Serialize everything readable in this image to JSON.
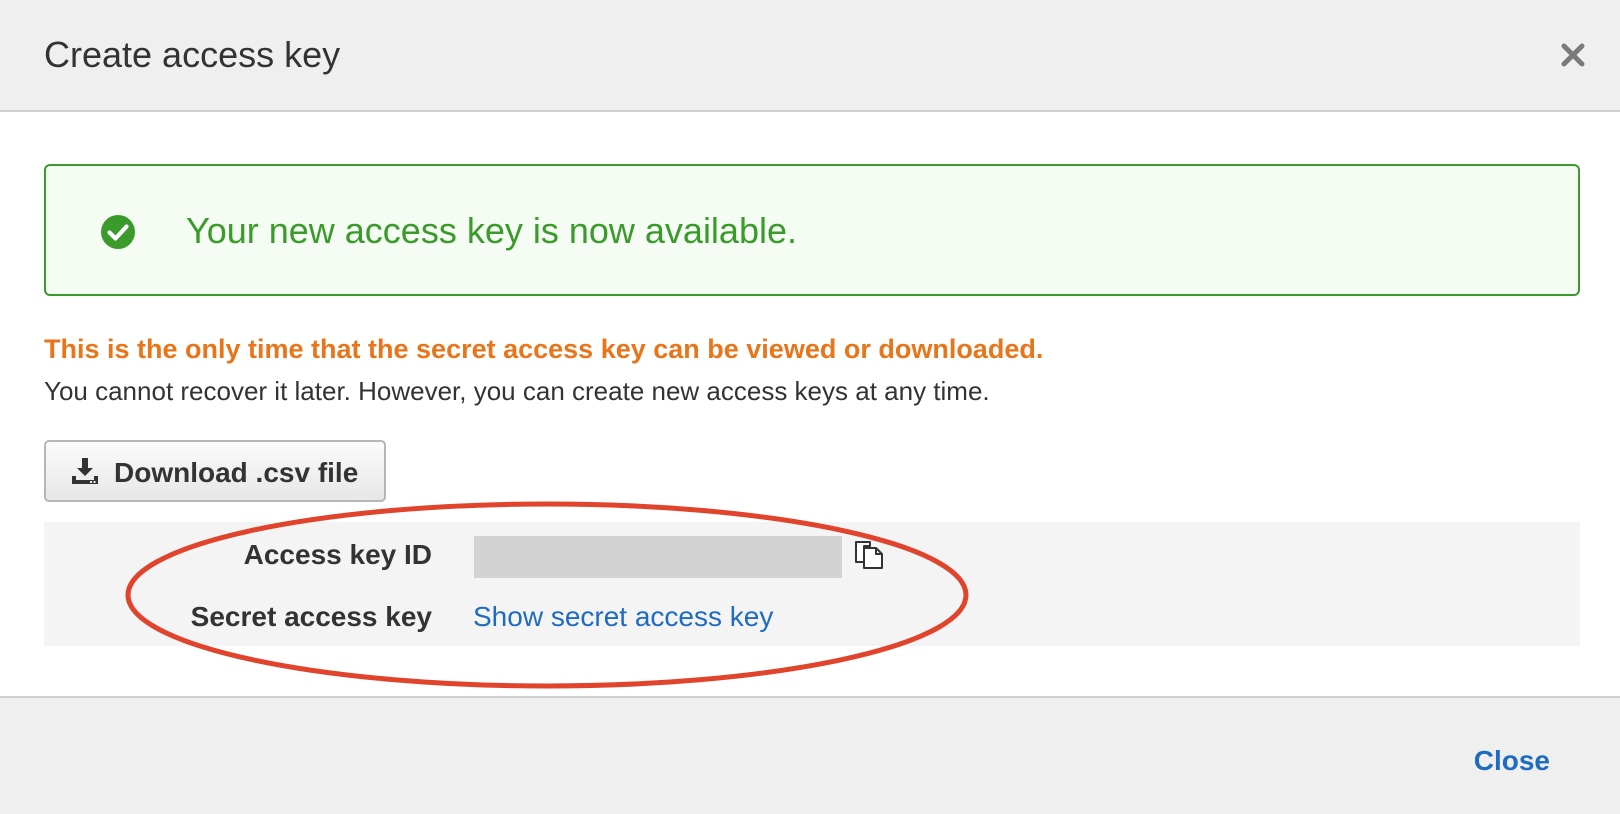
{
  "dialog": {
    "title": "Create access key",
    "close_icon": "close-x-icon"
  },
  "success_alert": {
    "icon": "check-circle-icon",
    "message": "Your new access key is now available.",
    "color": "#3a9a2a"
  },
  "warning": {
    "text": "This is the only time that the secret access key can be viewed or downloaded.",
    "color": "#e8751a"
  },
  "info": {
    "text": "You cannot recover it later. However, you can create new access keys at any time."
  },
  "download_button": {
    "icon": "download-icon",
    "label": "Download .csv file"
  },
  "keys": {
    "access_key_id_label": "Access key ID",
    "access_key_id_value": "",
    "copy_icon": "copy-icon",
    "secret_access_key_label": "Secret access key",
    "show_secret_link": "Show secret access key"
  },
  "footer": {
    "close_label": "Close"
  },
  "colors": {
    "link": "#1e6bc1",
    "annotation": "#e0442c"
  }
}
